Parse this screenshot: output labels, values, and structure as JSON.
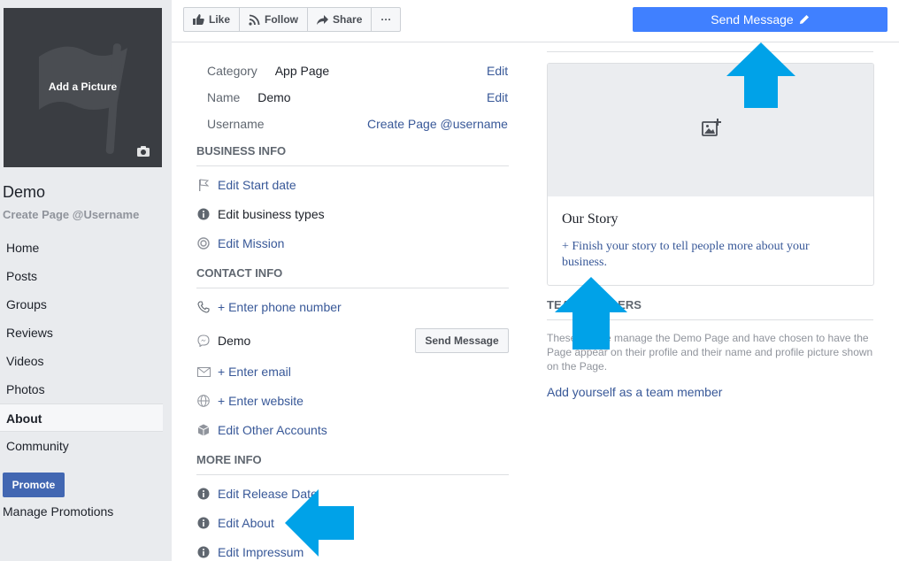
{
  "sidebar": {
    "cover_label": "Add a Picture",
    "page_name": "Demo",
    "page_username": "Create Page @Username",
    "nav": [
      "Home",
      "Posts",
      "Groups",
      "Reviews",
      "Videos",
      "Photos",
      "About",
      "Community"
    ],
    "active_nav": "About",
    "promote_label": "Promote",
    "manage_promotions": "Manage Promotions"
  },
  "topbar": {
    "like": "Like",
    "follow": "Follow",
    "share": "Share",
    "more": "···",
    "send_message": "Send Message"
  },
  "general": {
    "category_label": "Category",
    "category_value": "App Page",
    "name_label": "Name",
    "name_value": "Demo",
    "username_label": "Username",
    "edit": "Edit",
    "create_username": "Create Page @username"
  },
  "business_info": {
    "heading": "BUSINESS INFO",
    "start_date": "Edit Start date",
    "business_types": "Edit business types",
    "mission": "Edit Mission"
  },
  "contact_info": {
    "heading": "CONTACT INFO",
    "phone": "+ Enter phone number",
    "messenger": "Demo",
    "send_message": "Send Message",
    "email": "+ Enter email",
    "website": "+ Enter website",
    "other_accounts": "Edit Other Accounts"
  },
  "more_info": {
    "heading": "MORE INFO",
    "release_date": "Edit Release Date",
    "about": "Edit About",
    "impressum": "Edit Impressum"
  },
  "story": {
    "title": "Our Story",
    "text": "+ Finish your story to tell people more about your business."
  },
  "team": {
    "heading": "TEAM MEMBERS",
    "description": "These people manage the Demo Page and have chosen to have the Page appear on their profile and their name and profile picture shown on the Page.",
    "add": "Add yourself as a team member"
  },
  "colors": {
    "accent": "#4080ff",
    "link": "#385898",
    "annotation_arrow": "#00a2e8"
  }
}
